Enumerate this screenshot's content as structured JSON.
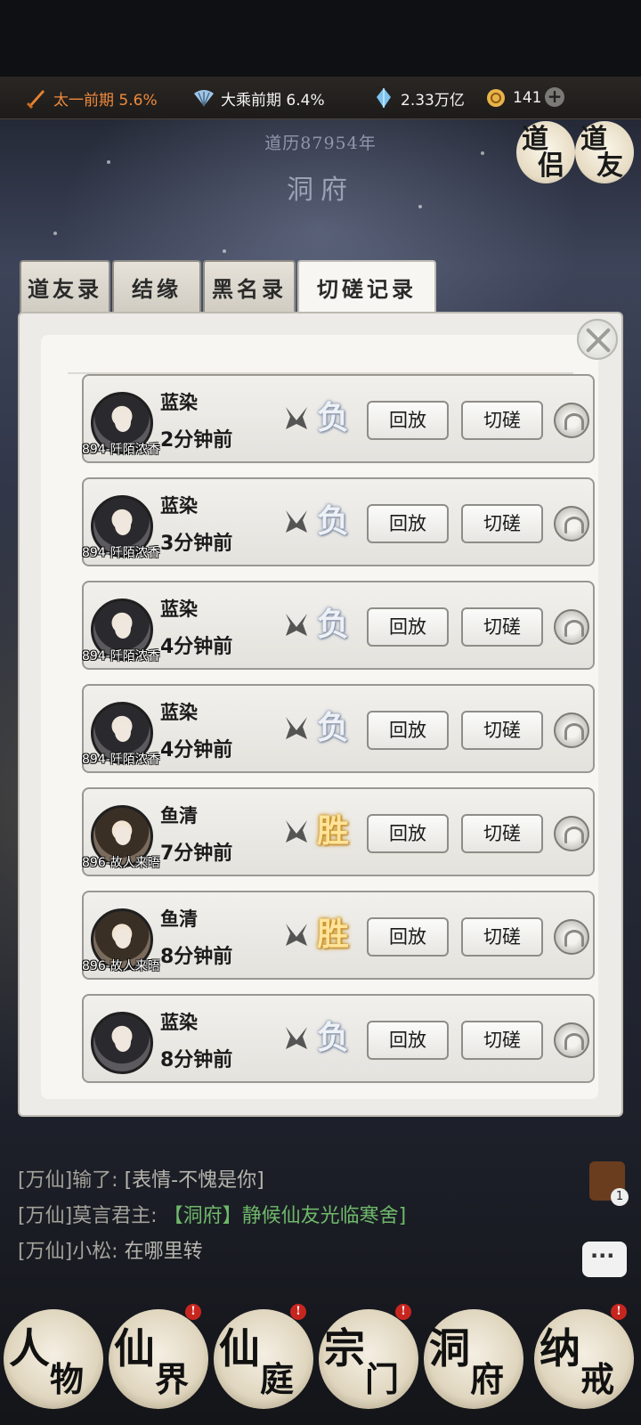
{
  "resources": {
    "realm1": "太一前期 5.6%",
    "realm2": "大乘前期 6.4%",
    "spirit_stone": "2.33万亿",
    "coins": "141"
  },
  "header": {
    "year": "道历87954年",
    "place": "洞府",
    "companion_btn": [
      "道侣",
      "道友"
    ]
  },
  "tabs": [
    "道友录",
    "结缘",
    "黑名录",
    "切磋记录"
  ],
  "active_tab": "切磋记录",
  "records": [
    {
      "name": "蓝染",
      "time": "2分钟前",
      "server": "894-阡陌浓香",
      "result": "负",
      "outcome": "lose",
      "replay": "回放",
      "spar": "切磋"
    },
    {
      "name": "蓝染",
      "time": "3分钟前",
      "server": "894-阡陌浓香",
      "result": "负",
      "outcome": "lose",
      "replay": "回放",
      "spar": "切磋"
    },
    {
      "name": "蓝染",
      "time": "4分钟前",
      "server": "894-阡陌浓香",
      "result": "负",
      "outcome": "lose",
      "replay": "回放",
      "spar": "切磋"
    },
    {
      "name": "蓝染",
      "time": "4分钟前",
      "server": "894-阡陌浓香",
      "result": "负",
      "outcome": "lose",
      "replay": "回放",
      "spar": "切磋"
    },
    {
      "name": "鱼清",
      "time": "7分钟前",
      "server": "896-故人来晤",
      "result": "胜",
      "outcome": "win",
      "replay": "回放",
      "spar": "切磋"
    },
    {
      "name": "鱼清",
      "time": "8分钟前",
      "server": "896-故人来晤",
      "result": "胜",
      "outcome": "win",
      "replay": "回放",
      "spar": "切磋"
    },
    {
      "name": "蓝染",
      "time": "8分钟前",
      "server": "",
      "result": "负",
      "outcome": "lose",
      "replay": "回放",
      "spar": "切磋"
    }
  ],
  "chat": [
    {
      "channel": "[万仙]",
      "name": "输了:",
      "msg": "[表情-不愧是你]",
      "green": false
    },
    {
      "channel": "[万仙]",
      "name": "莫言君主:",
      "msg": "【洞府】静候仙友光临寒舍]",
      "green": true
    },
    {
      "channel": "[万仙]",
      "name": "小松:",
      "msg": "在哪里转",
      "green": false
    }
  ],
  "mail_count": "1",
  "nav": [
    {
      "c1": "人",
      "c2": "物",
      "badge": false
    },
    {
      "c1": "仙",
      "c2": "界",
      "badge": true
    },
    {
      "c1": "仙",
      "c2": "庭",
      "badge": true
    },
    {
      "c1": "宗",
      "c2": "门",
      "badge": true
    },
    {
      "c1": "洞",
      "c2": "府",
      "badge": false
    },
    {
      "c1": "纳",
      "c2": "戒",
      "badge": true
    }
  ],
  "badge_mark": "!",
  "colors": {
    "accent_realm": "#f08a3c",
    "win": "#ffe39a",
    "lose": "#eef1f6",
    "chat_green": "#6fb86a"
  }
}
